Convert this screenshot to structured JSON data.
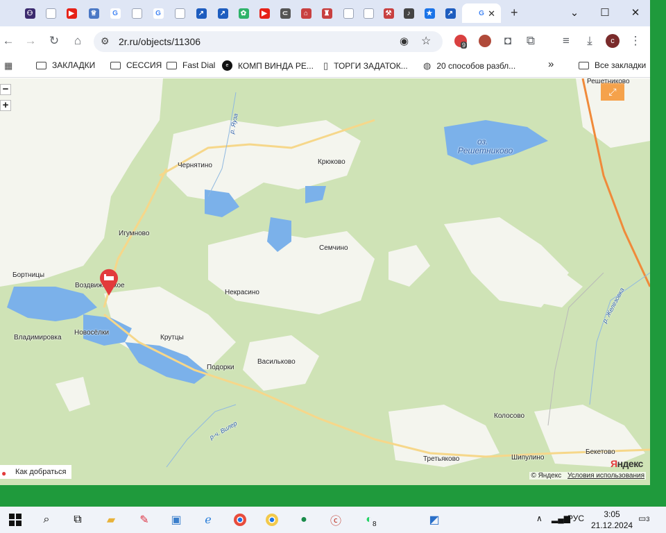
{
  "browser": {
    "tabs": [
      {
        "icon": "app-icon",
        "color": "#3b2a6e",
        "glyph": "⚇"
      },
      {
        "icon": "doc-icon",
        "color": "#dfe6f5",
        "glyph": ""
      },
      {
        "icon": "youtube-icon",
        "color": "#e62117",
        "glyph": "▶"
      },
      {
        "icon": "emblem-icon",
        "color": "#4a78c5",
        "glyph": "♕"
      },
      {
        "icon": "google-icon",
        "color": "#ffffff",
        "glyph": "G"
      },
      {
        "icon": "doc-icon",
        "color": "#dfe6f5",
        "glyph": ""
      },
      {
        "icon": "google-icon",
        "color": "#ffffff",
        "glyph": "G"
      },
      {
        "icon": "doc-icon",
        "color": "#dfe6f5",
        "glyph": ""
      },
      {
        "icon": "arrow-logo-icon",
        "color": "#1e5dbf",
        "glyph": "↗"
      },
      {
        "icon": "arrow-logo-icon",
        "color": "#1e5dbf",
        "glyph": "↗"
      },
      {
        "icon": "apps-icon",
        "color": "#2fb36a",
        "glyph": "✿"
      },
      {
        "icon": "youtube-icon",
        "color": "#e62117",
        "glyph": "▶"
      },
      {
        "icon": "link-icon",
        "color": "#555555",
        "glyph": "⊂"
      },
      {
        "icon": "building-icon",
        "color": "#c84040",
        "glyph": "⌂"
      },
      {
        "icon": "tower-icon",
        "color": "#c84040",
        "glyph": "♜"
      },
      {
        "icon": "doc-icon",
        "color": "#dfe6f5",
        "glyph": ""
      },
      {
        "icon": "doc-icon",
        "color": "#dfe6f5",
        "glyph": ""
      },
      {
        "icon": "hammer-icon",
        "color": "#c84040",
        "glyph": "⚒"
      },
      {
        "icon": "speaker-icon",
        "color": "#444444",
        "glyph": "♪"
      },
      {
        "icon": "star-icon",
        "color": "#1a73e8",
        "glyph": "★"
      },
      {
        "icon": "arrow-logo-icon",
        "color": "#1e5dbf",
        "glyph": "↗"
      },
      {
        "icon": "google-icon",
        "color": "#ffffff",
        "glyph": "G"
      }
    ],
    "active_tab_index": 21,
    "new_tab": "+",
    "url": "2r.ru/objects/11306",
    "extension_badge": "9",
    "profile_initial": "c"
  },
  "bookmarks": [
    {
      "label": "",
      "icon": "apps-grid-icon"
    },
    {
      "label": "ЗАКЛАДКИ",
      "icon": "folder-icon"
    },
    {
      "label": "СЕССИЯ",
      "icon": "folder-icon"
    },
    {
      "label": "Fast Dial",
      "icon": "folder-icon"
    },
    {
      "label": "КОМП ВИНДА РЕ...",
      "icon": "ebay-icon"
    },
    {
      "label": "ТОРГИ ЗАДАТОК...",
      "icon": "page-icon"
    },
    {
      "label": "20 способов разбл...",
      "icon": "globe-icon"
    }
  ],
  "bookmarks_more": "»",
  "all_bookmarks": "Все закладки",
  "map": {
    "zoom_out": "−",
    "zoom_in": "+",
    "places": [
      {
        "name": "Решетниково",
        "kind": "town"
      },
      {
        "name": "оз.",
        "kind": "water"
      },
      {
        "name": "Решетниково",
        "kind": "water"
      },
      {
        "name": "Чернятино",
        "kind": "village"
      },
      {
        "name": "Крюково",
        "kind": "village"
      },
      {
        "name": "Игумново",
        "kind": "village"
      },
      {
        "name": "Семчино",
        "kind": "village"
      },
      {
        "name": "Бортницы",
        "kind": "village"
      },
      {
        "name": "Воздвиженское",
        "kind": "village"
      },
      {
        "name": "Некрасино",
        "kind": "village"
      },
      {
        "name": "Владимировка",
        "kind": "village"
      },
      {
        "name": "Новосёлки",
        "kind": "village"
      },
      {
        "name": "Крутцы",
        "kind": "village"
      },
      {
        "name": "Подорки",
        "kind": "village"
      },
      {
        "name": "Васильково",
        "kind": "village"
      },
      {
        "name": "Колосово",
        "kind": "village"
      },
      {
        "name": "Третьяково",
        "kind": "village"
      },
      {
        "name": "Шипулино",
        "kind": "village"
      },
      {
        "name": "Бекетово",
        "kind": "village"
      }
    ],
    "rivers": [
      "р. Яуза",
      "р. Железовка",
      "р-ч. Вилер"
    ],
    "route_link": "Как добраться",
    "copyright": "© Яндекс",
    "terms": "Условия использования",
    "logo_prefix": "Я",
    "logo_rest": "ндекс",
    "marker": "hotel-marker"
  },
  "taskbar": {
    "apps": [
      {
        "icon": "windows-start-icon"
      },
      {
        "icon": "search-icon"
      },
      {
        "icon": "task-view-icon"
      },
      {
        "icon": "file-explorer-icon"
      },
      {
        "icon": "paint-icon"
      },
      {
        "icon": "control-panel-icon"
      },
      {
        "icon": "internet-explorer-icon"
      },
      {
        "icon": "chrome-icon"
      },
      {
        "icon": "chrome-profile-icon"
      },
      {
        "icon": "green-app-icon"
      },
      {
        "icon": "c-app-icon"
      },
      {
        "icon": "whatsapp-icon"
      },
      {
        "icon": "photos-icon"
      }
    ],
    "whatsapp_badge": "8",
    "lang": "РУС",
    "time": "3:05",
    "date": "21.12.2024",
    "notifications": "3"
  }
}
